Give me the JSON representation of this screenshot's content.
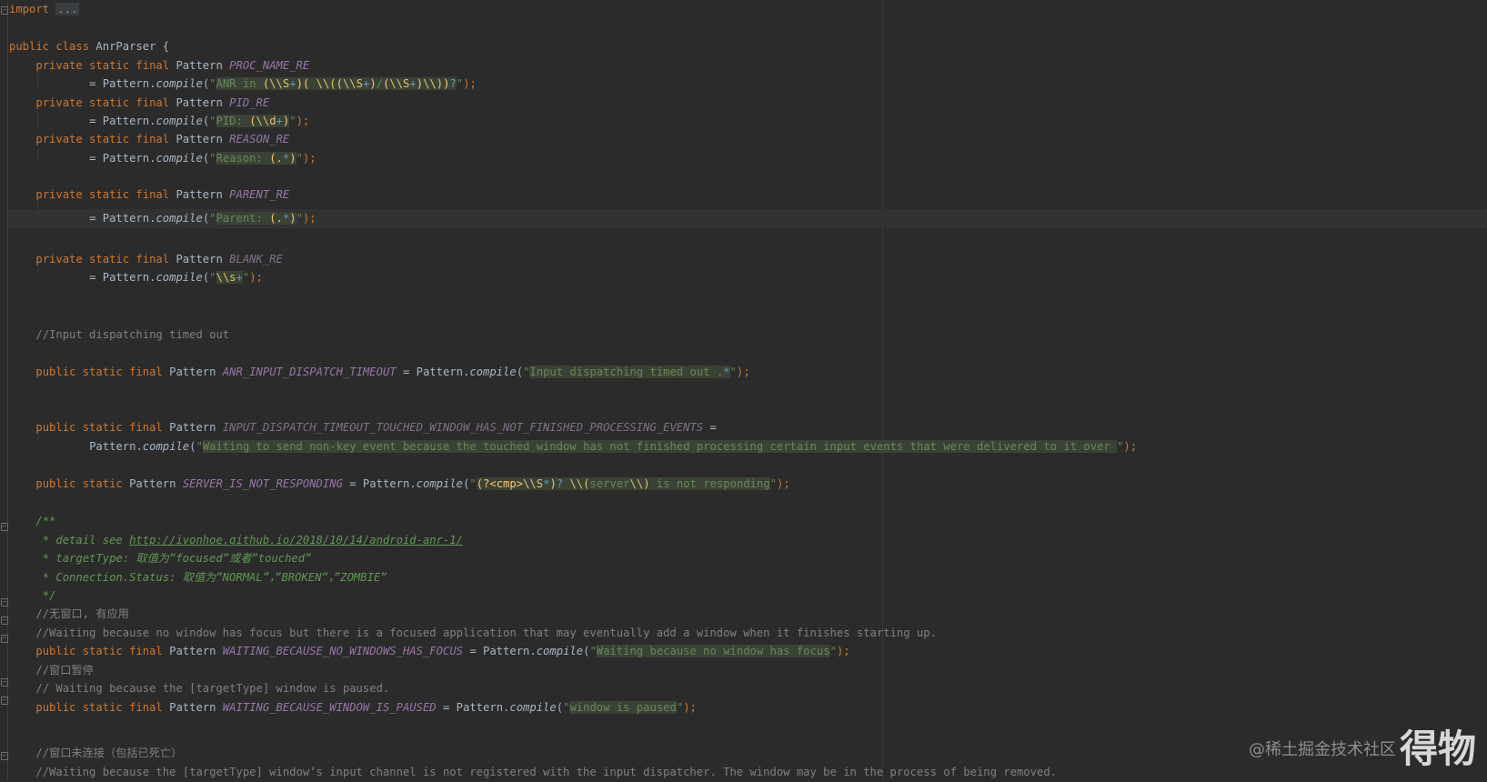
{
  "code": {
    "import_keyword": "import",
    "import_fold": "...",
    "class_decl": {
      "kw1": "public",
      "kw2": "class",
      "name": "AnrParser",
      "brace": "{"
    },
    "fields": {
      "proc_name": {
        "mods": "private static final",
        "type": "Pattern",
        "name": "PROC_NAME_RE",
        "assign": "= Pattern.",
        "method": "compile",
        "open": "(\"",
        "regex_parts": [
          "ANR in ",
          "(",
          "\\\\S",
          "+",
          ")",
          "( ",
          "\\\\(",
          "(",
          "\\\\S",
          "+",
          ")",
          "/",
          "(",
          "\\\\S",
          "+",
          ")",
          "\\\\)",
          ")",
          "?"
        ],
        "close": "\");"
      },
      "pid": {
        "mods": "private static final",
        "type": "Pattern",
        "name": "PID_RE",
        "assign": "= Pattern.",
        "method": "compile",
        "open": "(\"",
        "regex_parts": [
          "PID: ",
          "(",
          "\\\\d",
          "+",
          ")"
        ],
        "close": "\");"
      },
      "reason": {
        "mods": "private static final",
        "type": "Pattern",
        "name": "REASON_RE",
        "assign": "= Pattern.",
        "method": "compile",
        "open": "(\"",
        "regex_parts": [
          "Reason: ",
          "(",
          ".",
          "*",
          ")"
        ],
        "close": "\");"
      },
      "parent": {
        "mods": "private static final",
        "type": "Pattern",
        "name": "PARENT_RE",
        "assign": "= Pattern.",
        "method": "compile",
        "open": "(\"",
        "regex_parts": [
          "Parent: ",
          "(",
          ".",
          "*",
          ")"
        ],
        "close": "\");"
      },
      "blank": {
        "mods": "private static final",
        "type": "Pattern",
        "name": "BLANK_RE",
        "assign": "= Pattern.",
        "method": "compile",
        "open": "(\"",
        "regex_parts": [
          "\\\\s",
          "+"
        ],
        "close": "\");"
      }
    },
    "comment_input_dispatch": "//Input dispatching timed out",
    "anr_input": {
      "mods": "public static final",
      "type": "Pattern",
      "name": "ANR_INPUT_DISPATCH_TIMEOUT",
      "assign": " = Pattern.",
      "method": "compile",
      "open": "(\"",
      "regex_text": "Input dispatching timed out .",
      "regex_q": "*",
      "close": "\");"
    },
    "touched": {
      "mods": "public static final",
      "type": "Pattern",
      "name": "INPUT_DISPATCH_TIMEOUT_TOUCHED_WINDOW_HAS_NOT_FINISHED_PROCESSING_EVENTS",
      "eq": " =",
      "assign": "Pattern.",
      "method": "compile",
      "open": "(\"",
      "regex_text": "Waiting to send non-key event because the touched window has not finished processing certain input events that were delivered to it over ",
      "close": "\");"
    },
    "server": {
      "mods": "public static",
      "type": "Pattern",
      "name": "SERVER_IS_NOT_RESPONDING",
      "assign": " = Pattern.",
      "method": "compile",
      "open": "(\"",
      "regex_parts": [
        "(",
        "?<cmp>",
        "\\\\S",
        "*",
        ")",
        "?",
        " ",
        "\\\\(",
        "server",
        "\\\\)",
        " is not responding"
      ],
      "close": "\");"
    },
    "javadoc": {
      "open": "/**",
      "line1_prefix": " * detail see ",
      "line1_link": "http://ivonhoe.github.io/2018/10/14/android-anr-1/",
      "line2": " * targetType: 取值为”focused”或者”touched”",
      "line3": " * Connection.Status: 取值为”NORMAL”，”BROKEN”，”ZOMBIE”",
      "close": " */"
    },
    "comment_no_window_cn": "//无窗口, 有应用",
    "comment_no_window_en": "//Waiting because no window has focus but there is a focused application that may eventually add a window when it finishes starting up.",
    "no_focus": {
      "mods": "public static final",
      "type": "Pattern",
      "name": "WAITING_BECAUSE_NO_WINDOWS_HAS_FOCUS",
      "assign": " = Pattern.",
      "method": "compile",
      "open": "(\"",
      "regex_text": "Waiting because no window has focus",
      "close": "\");"
    },
    "comment_paused_cn": "//窗口暂停",
    "comment_paused_en": "// Waiting because the [targetType] window is paused.",
    "paused": {
      "mods": "public static final",
      "type": "Pattern",
      "name": "WAITING_BECAUSE_WINDOW_IS_PAUSED",
      "assign": " = Pattern.",
      "method": "compile",
      "open": "(\"",
      "regex_text": "window is paused",
      "close": "\");"
    },
    "comment_unconnected_cn": "//窗口未连接（包括已死亡）",
    "comment_unconnected_en": "//Waiting because the [targetType] window’s input channel is not registered with the input dispatcher. The window may be in the process of being removed."
  },
  "watermark": {
    "site": "@稀土掘金技术社区",
    "brand": "得物"
  }
}
